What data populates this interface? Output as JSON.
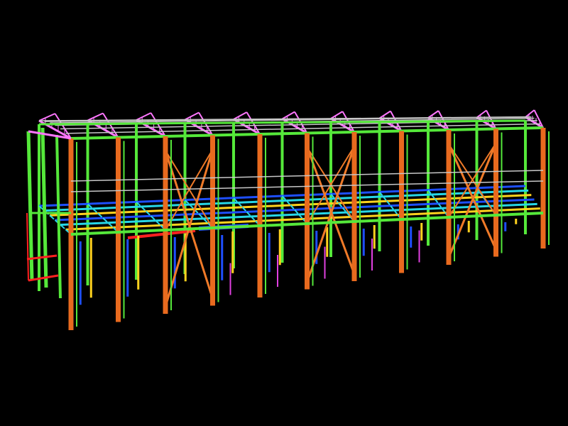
{
  "viewport": {
    "background": "#000000",
    "content": "3d-steel-structure-wireframe"
  },
  "member_colors": {
    "column_primary": "#e86a1e",
    "column_secondary": "#55e83a",
    "roof_truss": "#ff77ff",
    "roof_purlin": "#c8c8c8",
    "floor_beam_cyan": "#27d6e6",
    "floor_beam_blue": "#1e4fff",
    "floor_beam_yellow": "#ffd21e",
    "bracing_orange": "#f07a28",
    "stair_red": "#ff2020",
    "misc_magenta": "#e040e0"
  }
}
